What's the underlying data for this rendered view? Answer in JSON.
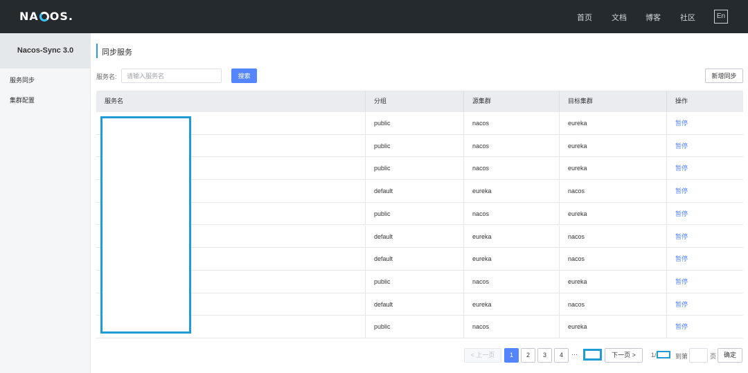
{
  "header": {
    "logo_text": "NACOS.",
    "nav": [
      "首页",
      "文档",
      "博客",
      "社区"
    ],
    "lang": "En"
  },
  "sidebar": {
    "title": "Nacos-Sync 3.0",
    "items": [
      {
        "label": "服务同步"
      },
      {
        "label": "集群配置"
      }
    ]
  },
  "main": {
    "title": "同步服务",
    "search": {
      "label": "服务名:",
      "placeholder": "请输入服务名",
      "button": "搜索"
    },
    "add_button": "新增同步"
  },
  "table": {
    "columns": [
      "服务名",
      "分组",
      "源集群",
      "目标集群",
      "操作"
    ],
    "rows": [
      {
        "group": "public",
        "source": "nacos",
        "target": "eureka",
        "action": "暂停"
      },
      {
        "group": "public",
        "source": "nacos",
        "target": "eureka",
        "action": "暂停"
      },
      {
        "group": "public",
        "source": "nacos",
        "target": "eureka",
        "action": "暂停"
      },
      {
        "group": "default",
        "source": "eureka",
        "target": "nacos",
        "action": "暂停"
      },
      {
        "group": "public",
        "source": "nacos",
        "target": "eureka",
        "action": "暂停"
      },
      {
        "group": "default",
        "source": "eureka",
        "target": "nacos",
        "action": "暂停"
      },
      {
        "group": "default",
        "source": "eureka",
        "target": "nacos",
        "action": "暂停"
      },
      {
        "group": "public",
        "source": "nacos",
        "target": "eureka",
        "action": "暂停"
      },
      {
        "group": "default",
        "source": "eureka",
        "target": "nacos",
        "action": "暂停"
      },
      {
        "group": "public",
        "source": "nacos",
        "target": "eureka",
        "action": "暂停"
      }
    ]
  },
  "pagination": {
    "prev": "< 上一页",
    "pages": [
      "1",
      "2",
      "3",
      "4"
    ],
    "current_page": "1",
    "ellipsis": "···",
    "next": "下一页 >",
    "current_prefix": "1/",
    "goto_label": "到第",
    "page_unit": "页",
    "confirm": "确定"
  },
  "colors": {
    "topbar": "#252a2f",
    "primary": "#5584ff",
    "accent": "#209bfa",
    "redaction": "#1f9cd4"
  }
}
